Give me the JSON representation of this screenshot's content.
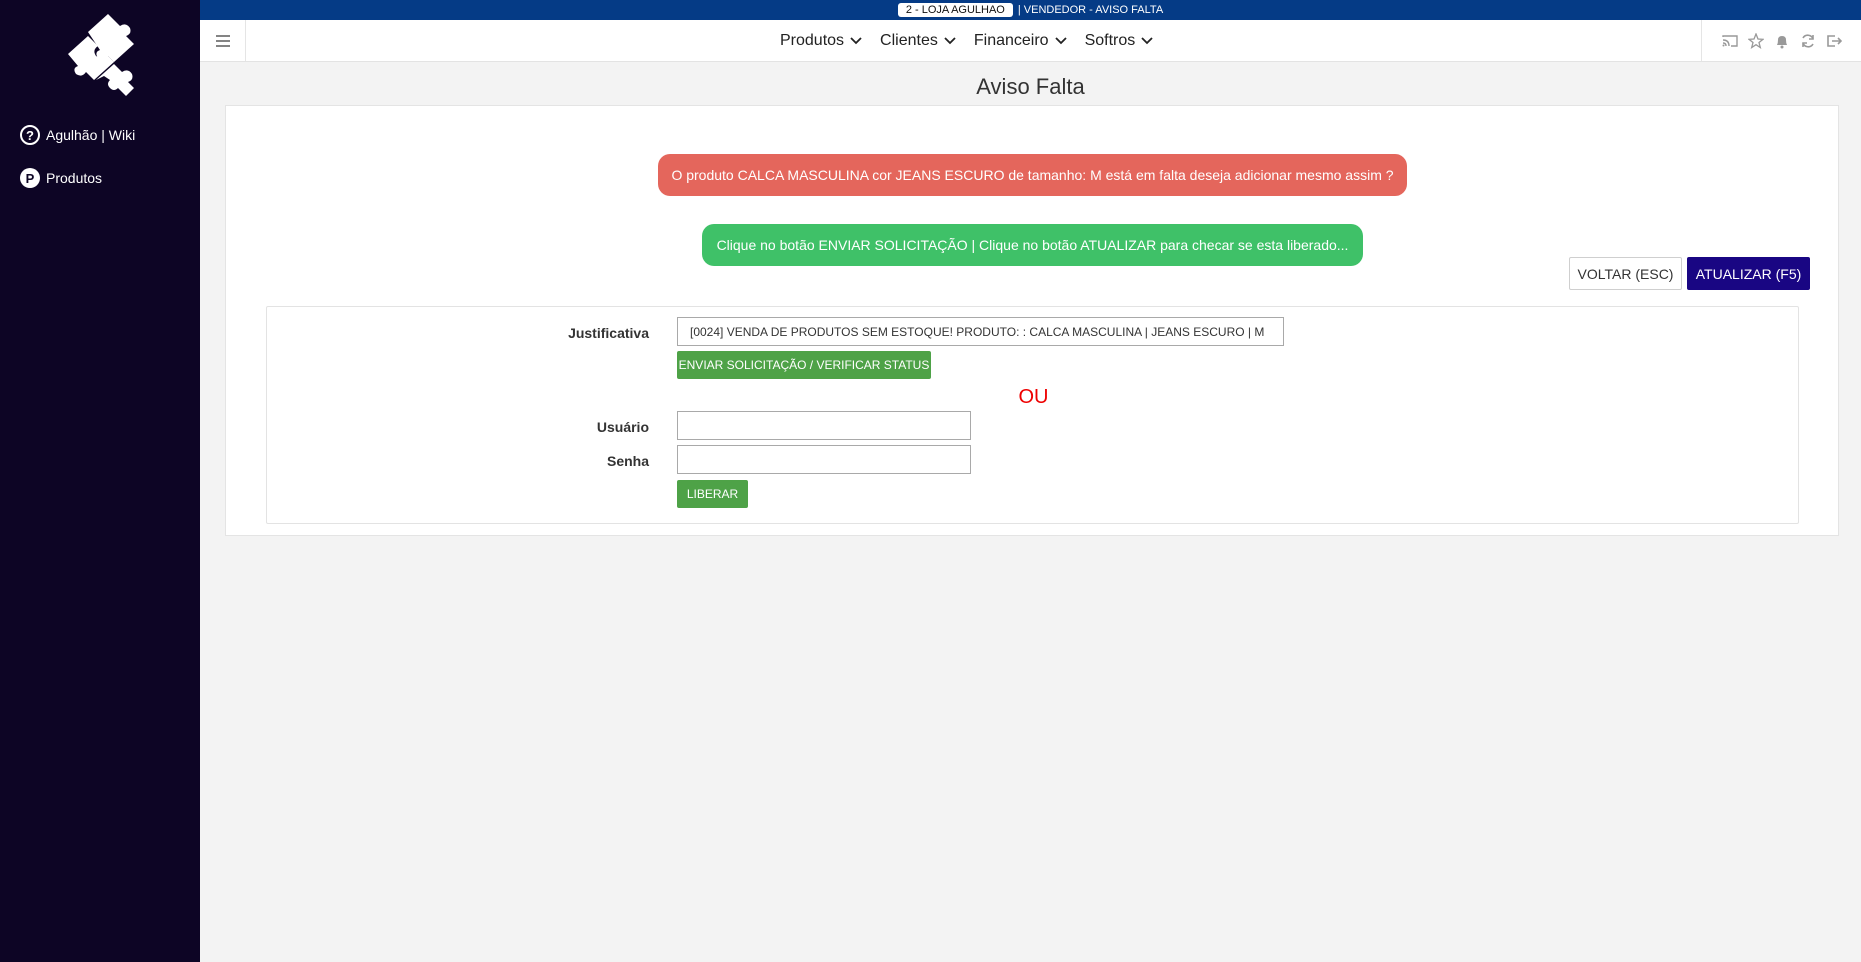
{
  "topbar": {
    "store": "2 - LOJA AGULHAO",
    "page": "| VENDEDOR - AVISO FALTA"
  },
  "sidebar": {
    "items": [
      {
        "icon": "question-circle-icon",
        "label": "Agulhão | Wiki"
      },
      {
        "icon": "p-circle-icon",
        "label": "Produtos"
      }
    ]
  },
  "nav": {
    "menu": [
      "Produtos",
      "Clientes",
      "Financeiro",
      "Softros"
    ],
    "tools": [
      "cast-icon",
      "star-icon",
      "bell-icon",
      "refresh-icon",
      "logout-icon"
    ]
  },
  "page": {
    "title": "Aviso Falta",
    "alert_red": "O produto CALCA MASCULINA cor JEANS ESCURO de tamanho: M está em falta deseja adicionar mesmo assim ?",
    "alert_green": "Clique no botão ENVIAR SOLICITAÇÃO | Clique no botão ATUALIZAR para checar se esta liberado...",
    "voltar_label": "VOLTAR (ESC)",
    "atualizar_label": "ATUALIZAR (F5)"
  },
  "form": {
    "justificativa_label": "Justificativa",
    "justificativa_value": "[0024] VENDA DE PRODUTOS SEM ESTOQUE! PRODUTO: : CALCA MASCULINA | JEANS ESCURO | M",
    "enviar_label": "ENVIAR SOLICITAÇÃO / VERIFICAR STATUS",
    "ou": "OU",
    "usuario_label": "Usuário",
    "usuario_value": "",
    "senha_label": "Senha",
    "senha_value": "",
    "liberar_label": "LIBERAR"
  },
  "colors": {
    "sidebar": "#0d0525",
    "topstrip": "#053b86",
    "alert_red": "#e4665c",
    "alert_green": "#3fc168",
    "primary": "#190683",
    "success": "#4ea247",
    "ou": "#ee0000"
  }
}
